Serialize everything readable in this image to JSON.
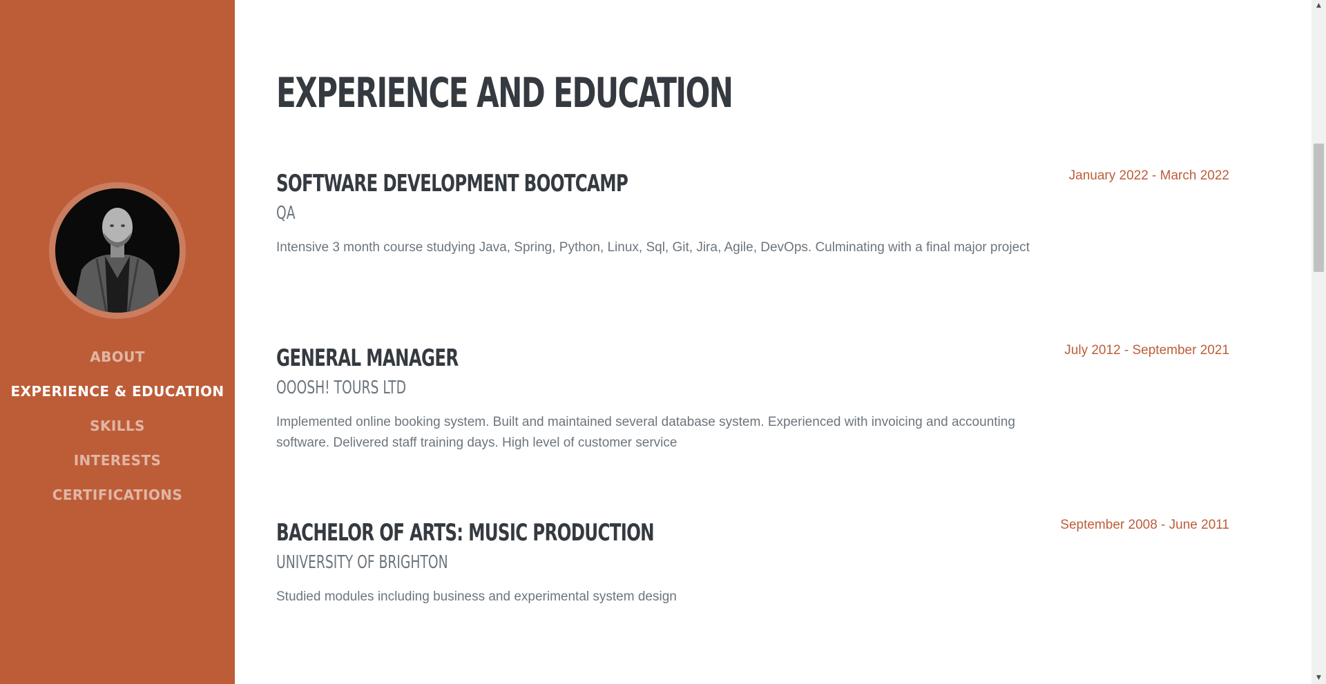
{
  "sidebar": {
    "nav": [
      {
        "label": "About",
        "active": false
      },
      {
        "label": "Experience & Education",
        "active": true
      },
      {
        "label": "Skills",
        "active": false
      },
      {
        "label": "Interests",
        "active": false
      },
      {
        "label": "Certifications",
        "active": false
      }
    ],
    "colors": {
      "background": "#bd5d38",
      "active_link": "#ffffff"
    }
  },
  "main": {
    "section_title": "Experience and Education",
    "entries": [
      {
        "title": "Software Development Bootcamp",
        "subtitle": "QA",
        "description": "Intensive 3 month course studying Java, Spring, Python, Linux, Sql, Git, Jira, Agile, DevOps. Culminating with a final major project",
        "date": "January 2022 - March 2022"
      },
      {
        "title": "General Manager",
        "subtitle": "Ooosh! Tours Ltd",
        "description": "Implemented online booking system. Built and maintained several database system. Experienced with invoicing and accounting software. Delivered staff training days. High level of customer service",
        "date": "July 2012 - September 2021"
      },
      {
        "title": "Bachelor of Arts: Music Production",
        "subtitle": "University of Brighton",
        "description": "Studied modules including business and experimental system design",
        "date": "September 2008 - June 2011"
      }
    ],
    "colors": {
      "heading": "#343a40",
      "muted": "#6c757d",
      "accent": "#bd5d38"
    }
  }
}
